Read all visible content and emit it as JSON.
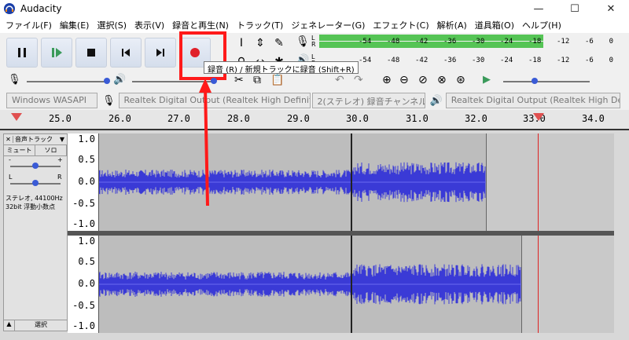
{
  "window": {
    "title": "Audacity",
    "minimize": "—",
    "maximize": "☐",
    "close": "✕"
  },
  "menu": [
    "ファイル(F)",
    "編集(E)",
    "選択(S)",
    "表示(V)",
    "録音と再生(N)",
    "トラック(T)",
    "ジェネレーター(G)",
    "エフェクト(C)",
    "解析(A)",
    "道具箱(O)",
    "ヘルプ(H)"
  ],
  "meter": {
    "ticks": [
      "-54",
      "-48",
      "-42",
      "-36",
      "-30",
      "-24",
      "-18",
      "-12",
      "-6",
      "0"
    ],
    "record_level": 0.75,
    "play_level": 0
  },
  "tooltip": "録音 (R) / 新規トラックに録音 (Shift+R)",
  "devices": {
    "host": "Windows WASAPI",
    "record_device": "Realtek Digital Output (Realtek High Definiti",
    "channels": "2(ステレオ) 録音チャンネル",
    "playback_device": "Realtek Digital Output (Realtek High Definiti"
  },
  "ruler": {
    "labels": [
      "25.0",
      "26.0",
      "27.0",
      "28.0",
      "29.0",
      "30.0",
      "31.0",
      "32.0",
      "33.0",
      "34.0"
    ]
  },
  "track": {
    "name": "音声トラック",
    "mute": "ミュート",
    "solo": "ソロ",
    "gain_minus": "-",
    "gain_plus": "+",
    "pan_left": "L",
    "pan_right": "R",
    "info_line1": "ステレオ, 44100Hz",
    "info_line2": "32bit 浮動小数点",
    "select": "選択",
    "vruler_labels": [
      "1.0",
      "0.5",
      "0.0",
      "-0.5",
      "-1.0"
    ]
  },
  "colors": {
    "waveform": "#3a3ad6",
    "record": "#e0202a",
    "highlight": "#ff1a1a",
    "meter_green": "#55c455"
  }
}
